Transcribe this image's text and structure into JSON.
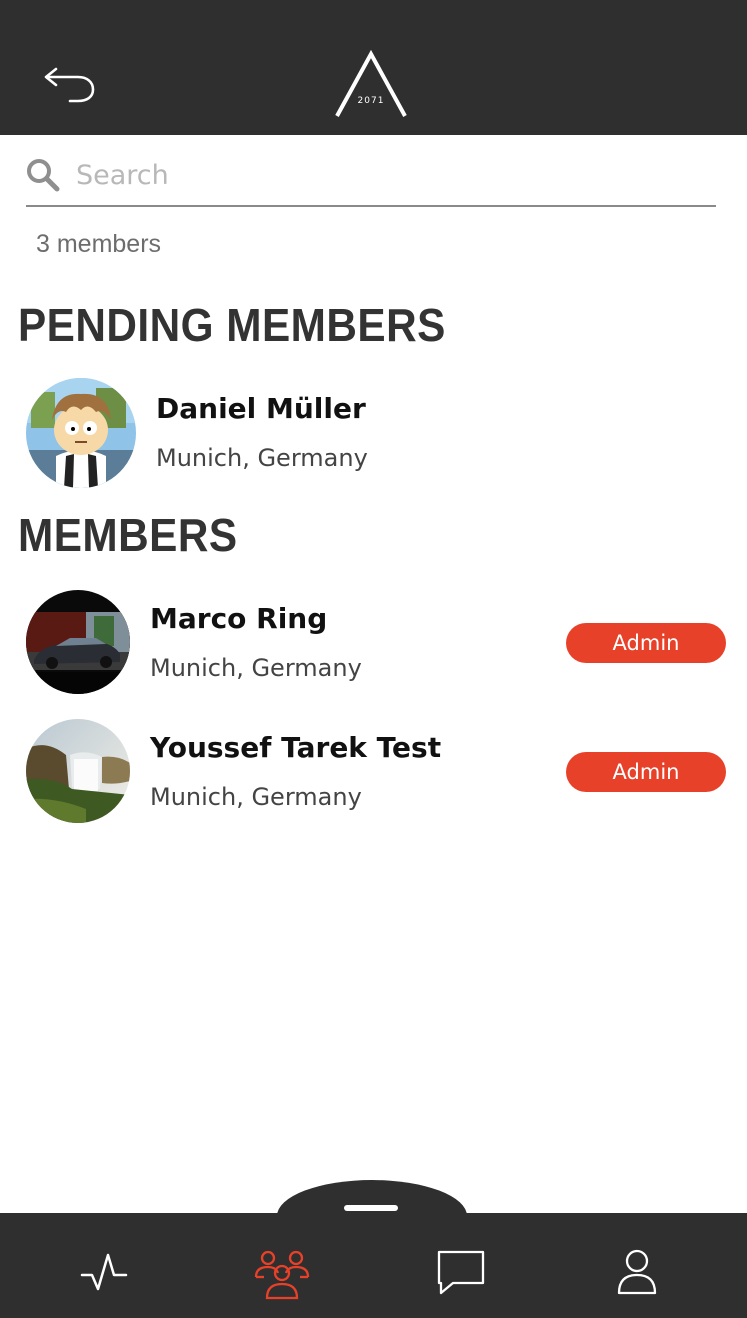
{
  "header": {
    "logo_text": "2071"
  },
  "search": {
    "placeholder": "Search",
    "value": ""
  },
  "member_count": "3 members",
  "pending_section": {
    "title": "PENDING MEMBERS",
    "members": [
      {
        "name": "Daniel Müller",
        "location": "Munich, Germany"
      }
    ]
  },
  "members_section": {
    "title": "MEMBERS",
    "members": [
      {
        "name": "Marco Ring",
        "location": "Munich, Germany",
        "role": "Admin"
      },
      {
        "name": "Youssef Tarek Test",
        "location": "Munich, Germany",
        "role": "Admin"
      }
    ]
  },
  "tabs": [
    {
      "icon": "activity-icon",
      "active": false
    },
    {
      "icon": "group-icon",
      "active": true
    },
    {
      "icon": "chat-icon",
      "active": false
    },
    {
      "icon": "profile-icon",
      "active": false
    }
  ],
  "colors": {
    "header_bg": "#2f2f2f",
    "accent": "#e8412a",
    "tab_icon": "#ffffff"
  }
}
